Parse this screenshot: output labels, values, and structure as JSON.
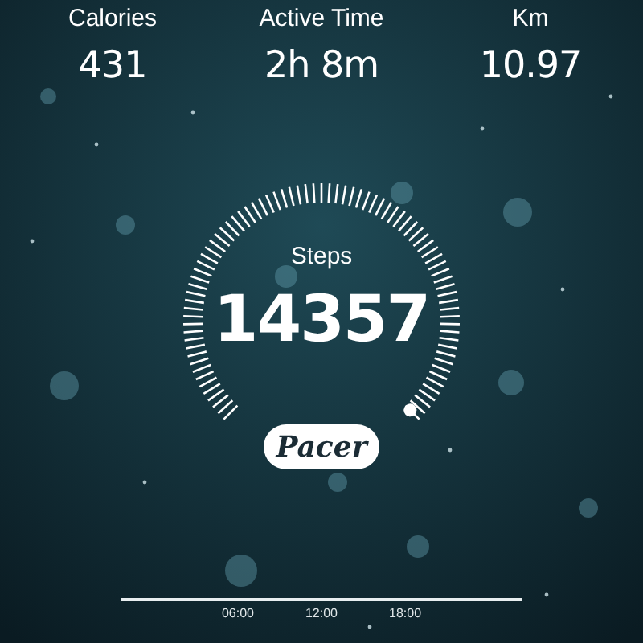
{
  "stats": [
    {
      "label": "Calories",
      "value": "431"
    },
    {
      "label": "Active Time",
      "value": "2h 8m"
    },
    {
      "label": "Km",
      "value": "10.97"
    }
  ],
  "steps": {
    "label": "Steps",
    "value": "14357"
  },
  "logo": "Pacer",
  "timeline": {
    "ticks": [
      "06:00",
      "12:00",
      "18:00"
    ]
  }
}
